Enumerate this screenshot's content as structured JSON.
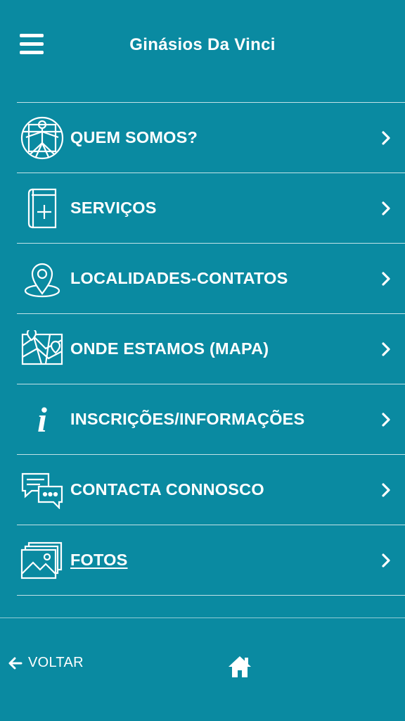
{
  "header": {
    "title": "Ginásios Da Vinci",
    "menu_icon": "hamburger-menu-icon"
  },
  "menu": {
    "items": [
      {
        "label": "QUEM SOMOS?",
        "icon": "vitruvian-man-icon"
      },
      {
        "label": "SERVIÇOS",
        "icon": "book-plus-icon"
      },
      {
        "label": "LOCALIDADES-CONTATOS",
        "icon": "location-pin-icon"
      },
      {
        "label": "ONDE ESTAMOS (MAPA)",
        "icon": "map-icon"
      },
      {
        "label": "INSCRIÇÕES/INFORMAÇÕES",
        "icon": "info-icon"
      },
      {
        "label": "CONTACTA CONNOSCO",
        "icon": "chat-bubbles-icon"
      },
      {
        "label": "FOTOS",
        "icon": "photos-icon"
      }
    ]
  },
  "footer": {
    "back_label": "VOLTAR",
    "home_icon": "home-icon"
  },
  "colors": {
    "background": "#0a8aa1",
    "text": "#ffffff"
  }
}
